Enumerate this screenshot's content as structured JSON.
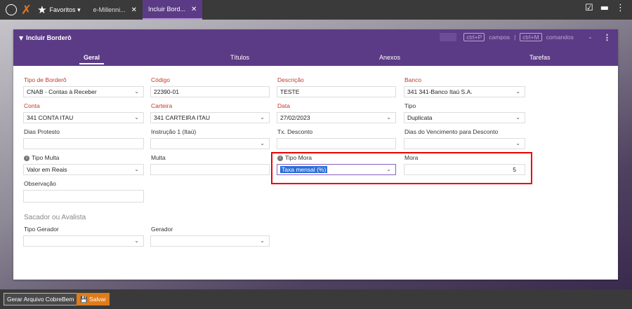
{
  "topbar": {
    "favorites_label": "Favoritos",
    "tabs": [
      {
        "label": "e-Millenni...",
        "close": "✕"
      },
      {
        "label": "Incluir Bord...",
        "close": "✕"
      }
    ]
  },
  "panel": {
    "title": "Incluir Borderô",
    "hint_fields_key": "ctrl+P",
    "hint_fields_text": "campos",
    "hint_separator": "|",
    "hint_commands_key": "ctrl+M",
    "hint_commands_text": "comandos",
    "tabs": [
      "Geral",
      "Títulos",
      "Anexos",
      "Tarefas"
    ]
  },
  "form": {
    "tipo_bordero": {
      "label": "Tipo de Borderô",
      "value": "CNAB - Contas à Receber"
    },
    "codigo": {
      "label": "Código",
      "value": "22390-01"
    },
    "descricao": {
      "label": "Descrição",
      "value": "TESTE"
    },
    "banco": {
      "label": "Banco",
      "value": "341 341-Banco Itaú S.A."
    },
    "conta": {
      "label": "Conta",
      "value": "341 CONTA ITAU"
    },
    "carteira": {
      "label": "Carteira",
      "value": "341 CARTEIRA ITAU"
    },
    "data": {
      "label": "Data",
      "value": "27/02/2023"
    },
    "tipo": {
      "label": "Tipo",
      "value": "Duplicata"
    },
    "dias_protesto": {
      "label": "Dias Protesto",
      "value": ""
    },
    "instrucao": {
      "label": "Instrução 1 (Itaú)",
      "value": ""
    },
    "tx_desconto": {
      "label": "Tx. Desconto",
      "value": ""
    },
    "dias_venc": {
      "label": "Dias do Vencimento para Desconto",
      "value": ""
    },
    "tipo_multa": {
      "label": "Tipo Multa",
      "value": "Valor em Reais"
    },
    "multa": {
      "label": "Multa",
      "value": ""
    },
    "tipo_mora": {
      "label": "Tipo Mora",
      "value": "Taxa mensal (%)"
    },
    "mora": {
      "label": "Mora",
      "value": "5"
    },
    "observacao": {
      "label": "Observação",
      "value": ""
    },
    "sacador_section": "Sacador ou Avalista",
    "tipo_gerador": {
      "label": "Tipo Gerador",
      "value": ""
    },
    "gerador": {
      "label": "Gerador",
      "value": ""
    }
  },
  "bottom": {
    "gerar_label": "Gerar Arquivo CobreBem",
    "salvar_label": "Salvar"
  },
  "colors": {
    "accent": "#5b3a86",
    "required_label": "#c0392b",
    "highlight": "#ee0000",
    "save_button": "#e07b1a"
  }
}
